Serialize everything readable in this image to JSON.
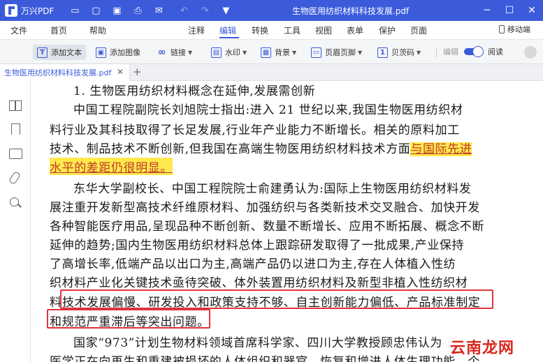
{
  "app": {
    "name": "万兴PDF",
    "window_title": "生物医用纺织材料科技发展.pdf"
  },
  "menu": {
    "items": [
      {
        "label": "文件"
      },
      {
        "label": "首页"
      },
      {
        "label": "帮助"
      },
      {
        "label": "注释"
      },
      {
        "label": "编辑"
      },
      {
        "label": "转换"
      },
      {
        "label": "工具"
      },
      {
        "label": "视图"
      },
      {
        "label": "表单"
      },
      {
        "label": "保护"
      },
      {
        "label": "页面"
      }
    ],
    "active": "编辑",
    "mobile_doc": "移动端"
  },
  "toolbar": {
    "tools": [
      {
        "label": "添加文本",
        "icon": "T"
      },
      {
        "label": "添加图像",
        "icon": "▣"
      },
      {
        "label": "链接",
        "icon": "∞"
      },
      {
        "label": "水印",
        "icon": "▤"
      },
      {
        "label": "背景",
        "icon": "▦"
      },
      {
        "label": "页眉页脚",
        "icon": "▭"
      },
      {
        "label": "贝茨码",
        "icon": "1"
      }
    ],
    "mode_edit": "编辑",
    "mode_read": "阅读"
  },
  "tabs": {
    "active_doc": "生物医用纺织材料科技发展.pdf",
    "close_symbol": "✕",
    "add_symbol": "+"
  },
  "document": {
    "heading_line": "1. 生物医用纺织材料概念在延伸,发展需创新",
    "lines": [
      "中国工程院副院长刘旭院士指出:进入 21 世纪以来,我国生物医用纺织材",
      "料行业及其科技取得了长足发展,行业年产业能力不断增长。相关的原料加工",
      "技术、制品技术不断创新,但我国在高端生物医用纺织材料技术方面"
    ],
    "highlight_1": "与国际先进",
    "highlight_2": "水平的差距仍很明显。",
    "para2": [
      "东华大学副校长、中国工程院院士俞建勇认为:国际上生物医用纺织材料发",
      "展注重开发新型高技术纤维原材料、加强纺织与各类新技术交叉融合、加快开发",
      "各种智能医疗用品,呈现品种不断创新、数量不断增长、应用不断拓展、概念不断",
      "延伸的趋势;国内生物医用纺织材料总体上跟踪研发取得了一批成果,产业保持",
      "了高增长率,低端产品以出口为主,高端产品仍以进口为主,存在人体植入性纺",
      "织材料产业化关键技术亟待突破、体外装置用纺织材料及新型非植入性纺织材"
    ],
    "boxed_prefix": "料",
    "boxed_1": "技术发展偏慢、研发投入和政策支持不够、自主创新能力偏低、产品标准制定",
    "boxed_2": "和规范严重滞后等突出问题。",
    "para3": [
      "国家“973”计划生物材料领域首席科学家、四川大学教授顾忠伟认为",
      "医学正在向再生和重建被损坏的人体组织和器官、恢复和增进人体生理功能、个"
    ]
  },
  "watermark": "云南龙网"
}
